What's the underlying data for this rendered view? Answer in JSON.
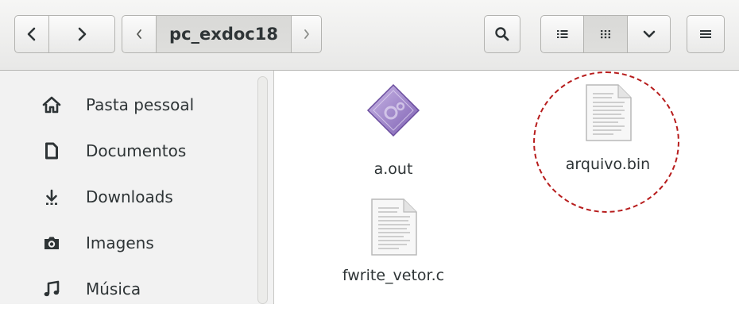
{
  "toolbar": {
    "back_icon": "chevron-left-icon",
    "forward_icon": "chevron-right-icon",
    "path_prev_icon": "chevron-left-icon",
    "path_current": "pc_exdoc18",
    "path_next_icon": "chevron-right-icon",
    "search_icon": "search-icon",
    "list_view_icon": "list-icon",
    "grid_view_icon": "grid-icon",
    "view_options_icon": "chevron-down-icon",
    "menu_icon": "hamburger-icon"
  },
  "sidebar": {
    "items": [
      {
        "label": "Pasta pessoal",
        "icon": "home-icon"
      },
      {
        "label": "Documentos",
        "icon": "document-icon"
      },
      {
        "label": "Downloads",
        "icon": "download-icon"
      },
      {
        "label": "Imagens",
        "icon": "camera-icon"
      },
      {
        "label": "Música",
        "icon": "music-icon"
      }
    ]
  },
  "files": [
    {
      "name": "a.out",
      "icon": "executable-icon"
    },
    {
      "name": "arquivo.bin",
      "icon": "text-file-icon",
      "highlighted": true
    },
    {
      "name": "fwrite_vetor.c",
      "icon": "text-file-icon"
    }
  ],
  "colors": {
    "highlight": "#b71c1c",
    "executable": "#9b7ec6"
  }
}
